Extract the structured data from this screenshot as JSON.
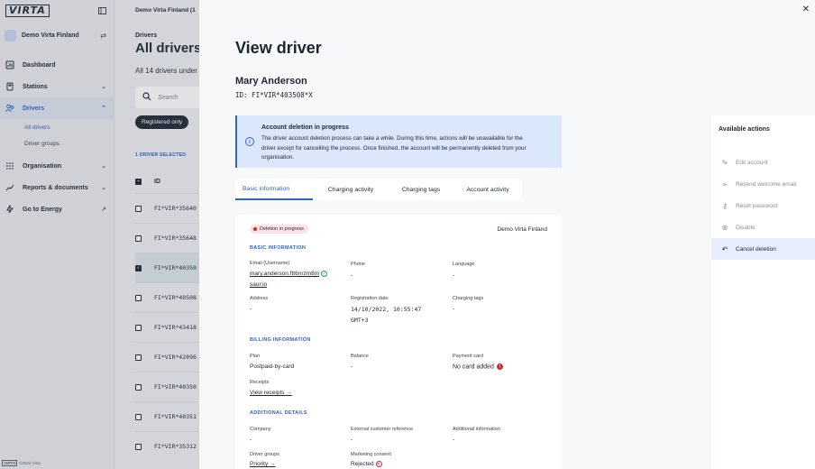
{
  "sidebar": {
    "logo": "VIRTA",
    "org_name": "Demo Virta Finland",
    "items": [
      {
        "label": "Dashboard"
      },
      {
        "label": "Stations"
      },
      {
        "label": "Drivers"
      },
      {
        "label": "Organisation"
      },
      {
        "label": "Reports & documents"
      },
      {
        "label": "Go to Energy"
      }
    ],
    "sub_items": [
      {
        "label": "All drivers"
      },
      {
        "label": "Driver groups"
      }
    ],
    "copyright": "©2024 Virta"
  },
  "main": {
    "breadcrumb": "Demo Virta Finland (1",
    "subtitle": "Drivers",
    "title": "All drivers",
    "description": "All 14 drivers under",
    "search_placeholder": "Search",
    "filter_pill": "Registered only",
    "selected_count": "1 DRIVER SELECTED",
    "column_id": "ID",
    "rows": [
      {
        "id": "FI*VIR*35640",
        "checked": false
      },
      {
        "id": "FI*VIR*35648",
        "checked": false
      },
      {
        "id": "FI*VIR*40350",
        "checked": true
      },
      {
        "id": "FI*VIR*40508",
        "checked": false
      },
      {
        "id": "FI*VIR*43418",
        "checked": false
      },
      {
        "id": "FI*VIR*42096",
        "checked": false
      },
      {
        "id": "FI*VIR*40350",
        "checked": false
      },
      {
        "id": "FI*VIR*40351",
        "checked": false
      },
      {
        "id": "FI*VIR*35312",
        "checked": false
      }
    ]
  },
  "drawer": {
    "title": "View driver",
    "name": "Mary Anderson",
    "id_line": "ID: FI*VIR*403508*X",
    "alert": {
      "title": "Account deletion in progress",
      "body": "The driver account deletion process can take a while. During this time, actions will be unavailable for the driver except for cancelling the process. Once finished, the account will be permanently deleted from your organisation."
    },
    "tabs": [
      {
        "label": "Basic information"
      },
      {
        "label": "Charging activity"
      },
      {
        "label": "Charging tags"
      },
      {
        "label": "Account activity"
      }
    ],
    "card": {
      "badge": "Deletion in progress",
      "org": "Demo Virta Finland",
      "basic_header": "BASIC INFORMATION",
      "email_label": "Email (Username)",
      "email_line1": "mary.anderson.ftt6nrzm8m",
      "email_line2": "saur.io",
      "phone_label": "Phone",
      "phone_value": "-",
      "language_label": "Language",
      "language_value": "-",
      "address_label": "Address",
      "address_value": "-",
      "reg_label": "Registration date",
      "reg_line1": "14/10/2022, 10:55:47",
      "reg_line2": "GMT+3",
      "tags_label": "Charging tags",
      "tags_value": "-",
      "billing_header": "BILLING INFORMATION",
      "plan_label": "Plan",
      "plan_value": "Postpaid-by-card",
      "balance_label": "Balance",
      "balance_value": "-",
      "payment_label": "Payment card",
      "payment_value": "No card added",
      "receipts_label": "Receipts",
      "receipts_link": "View receipts →",
      "additional_header": "ADDITIONAL DETAILS",
      "company_label": "Company",
      "company_value": "-",
      "extref_label": "External customer reference",
      "extref_value": "-",
      "addinfo_label": "Additional information",
      "addinfo_value": "-",
      "groups_label": "Driver groups",
      "groups_link": "Priority →",
      "marketing_label": "Marketing consent",
      "marketing_value": "Rejected"
    },
    "actions": {
      "title": "Available actions",
      "items": [
        {
          "label": "Edit account"
        },
        {
          "label": "Resend welcome email"
        },
        {
          "label": "Reset password"
        },
        {
          "label": "Disable"
        },
        {
          "label": "Cancel deletion"
        }
      ]
    }
  }
}
